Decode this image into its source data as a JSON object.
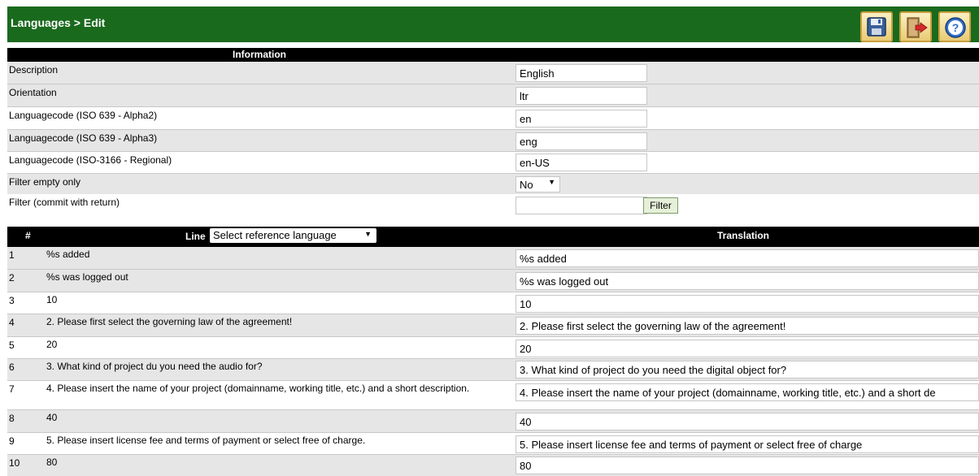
{
  "header": {
    "title": "Languages > Edit"
  },
  "toolbar": {
    "save_icon": "save-icon",
    "exit_icon": "exit-icon",
    "help_icon": "help-icon"
  },
  "information": {
    "title": "Information",
    "rows": [
      {
        "label": "Description",
        "value": "English"
      },
      {
        "label": "Orientation",
        "value": "ltr"
      },
      {
        "label": "Languagecode (ISO 639 - Alpha2)",
        "value": "en"
      },
      {
        "label": "Languagecode (ISO 639 - Alpha3)",
        "value": "eng"
      },
      {
        "label": "Languagecode (ISO-3166 - Regional)",
        "value": "en-US"
      }
    ],
    "filter_empty": {
      "label": "Filter empty only",
      "value": "No"
    },
    "filter": {
      "label": "Filter (commit with return)",
      "value": "",
      "button": "Filter"
    }
  },
  "table": {
    "col_num": "#",
    "col_line": "Line",
    "reference_select": "Select reference language",
    "col_translation": "Translation",
    "rows": [
      {
        "num": "1",
        "line": "%s added",
        "translation": "%s added"
      },
      {
        "num": "2",
        "line": "%s was logged out",
        "translation": "%s was logged out"
      },
      {
        "num": "3",
        "line": "10",
        "translation": "10"
      },
      {
        "num": "4",
        "line": "2. Please first select the governing law of the agreement!",
        "translation": "2. Please first select the governing law of the agreement!"
      },
      {
        "num": "5",
        "line": "20",
        "translation": "20"
      },
      {
        "num": "6",
        "line": "3. What kind of project du you need the audio for?",
        "translation": "3. What kind of project do you need the digital object for?"
      },
      {
        "num": "7",
        "line": "4. Please insert the name of your project (domainname, working title, etc.) and a short description.",
        "translation": "4. Please insert the name of your project (domainname, working title, etc.) and a short de"
      },
      {
        "num": "8",
        "line": "40",
        "translation": "40"
      },
      {
        "num": "9",
        "line": "5. Please insert license fee and terms of payment or select free of charge.",
        "translation": "5. Please insert license fee and terms of payment or select free of charge"
      },
      {
        "num": "10",
        "line": "80",
        "translation": "80"
      }
    ]
  },
  "colors": {
    "header_bg": "#1a6a1e",
    "section_bg": "#000000",
    "alt_row": "#e6e6e6"
  }
}
